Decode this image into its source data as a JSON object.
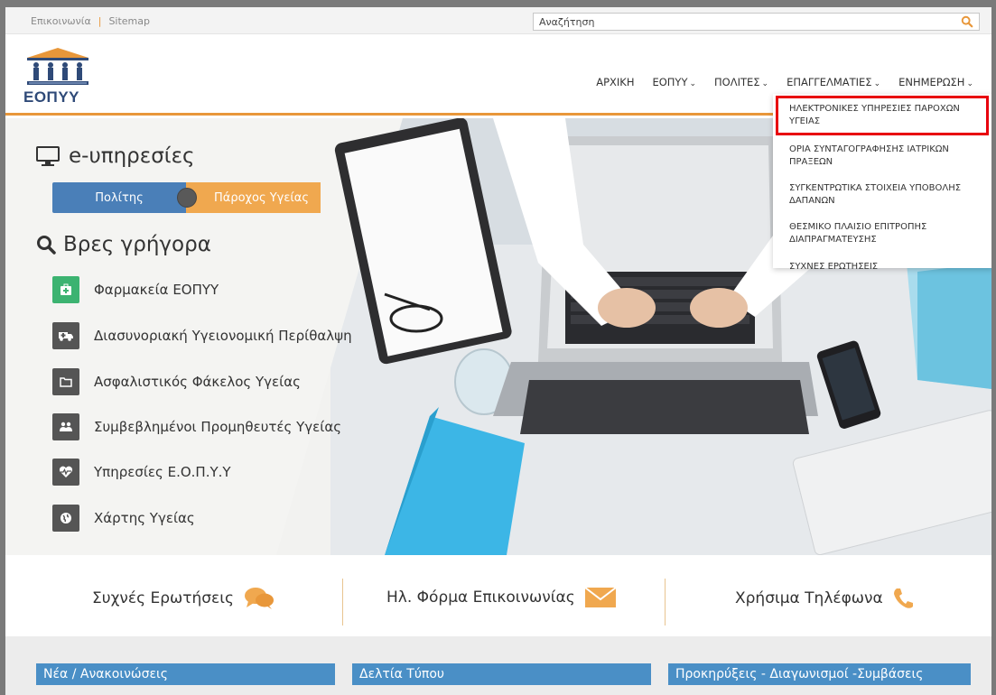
{
  "topbar": {
    "contact": "Επικοινωνία",
    "sitemap": "Sitemap",
    "search_placeholder": "Αναζήτηση"
  },
  "header": {
    "logo_text": "ΕΟΠΥΥ",
    "nav": [
      {
        "label": "ΑΡΧΙΚΗ",
        "dropdown": false
      },
      {
        "label": "ΕΟΠΥΥ",
        "dropdown": true
      },
      {
        "label": "ΠΟΛΙΤΕΣ",
        "dropdown": true
      },
      {
        "label": "ΕΠΑΓΓΕΛΜΑΤΙΕΣ",
        "dropdown": true
      },
      {
        "label": "ΕΝΗΜΕΡΩΣΗ",
        "dropdown": true
      }
    ]
  },
  "dropdown": {
    "items": [
      "ΗΛΕΚΤΡΟΝΙΚΕΣ ΥΠΗΡΕΣΙΕΣ ΠΑΡΟΧΩΝ ΥΓΕΙΑΣ",
      "ΟΡΙΑ ΣΥΝΤΑΓΟΓΡΑΦΗΣΗΣ ΙΑΤΡΙΚΩΝ ΠΡΑΞΕΩΝ",
      "ΣΥΓΚΕΝΤΡΩΤΙΚΑ ΣΤΟΙΧΕΙΑ ΥΠΟΒΟΛΗΣ ΔΑΠΑΝΩΝ",
      "ΘΕΣΜΙΚΟ ΠΛΑΙΣΙΟ ΕΠΙΤΡΟΠΗΣ ΔΙΑΠΡΑΓΜΑΤΕΥΣΗΣ",
      "ΣΥΧΝΕΣ ΕΡΩΤΗΣΕΙΣ"
    ],
    "highlight_color": "#e8000d"
  },
  "hero": {
    "eservices_title": "e-υπηρεσίες",
    "toggle_left": "Πολίτης",
    "toggle_right": "Πάροχος Υγείας",
    "quick_title": "Βρες γρήγορα",
    "quick_links": [
      {
        "label": "Φαρμακεία ΕΟΠΥΥ",
        "icon": "pharmacy-icon",
        "color": "#3cb371"
      },
      {
        "label": "Διασυνοριακή Υγειονομική Περίθαλψη",
        "icon": "ambulance-icon",
        "color": "#555555"
      },
      {
        "label": "Ασφαλιστικός Φάκελος Υγείας",
        "icon": "folder-icon",
        "color": "#555555"
      },
      {
        "label": "Συμβεβλημένοι Προμηθευτές Υγείας",
        "icon": "users-icon",
        "color": "#555555"
      },
      {
        "label": "Υπηρεσίες Ε.Ο.Π.Υ.Υ",
        "icon": "heartbeat-icon",
        "color": "#555555"
      },
      {
        "label": "Χάρτης Υγείας",
        "icon": "globe-icon",
        "color": "#555555"
      }
    ]
  },
  "links": {
    "faq": "Συχνές Ερωτήσεις",
    "contact_form": "Ηλ. Φόρμα Επικοινωνίας",
    "phones": "Χρήσιμα Τηλέφωνα"
  },
  "news": {
    "columns": [
      "Νέα / Ανακοινώσεις",
      "Δελτία Τύπου",
      "Προκηρύξεις - Διαγωνισμοί -Συμβάσεις"
    ]
  },
  "colors": {
    "accent_orange": "#e8973a",
    "blue": "#4a7fb8",
    "news_blue": "#4a8fc6"
  }
}
